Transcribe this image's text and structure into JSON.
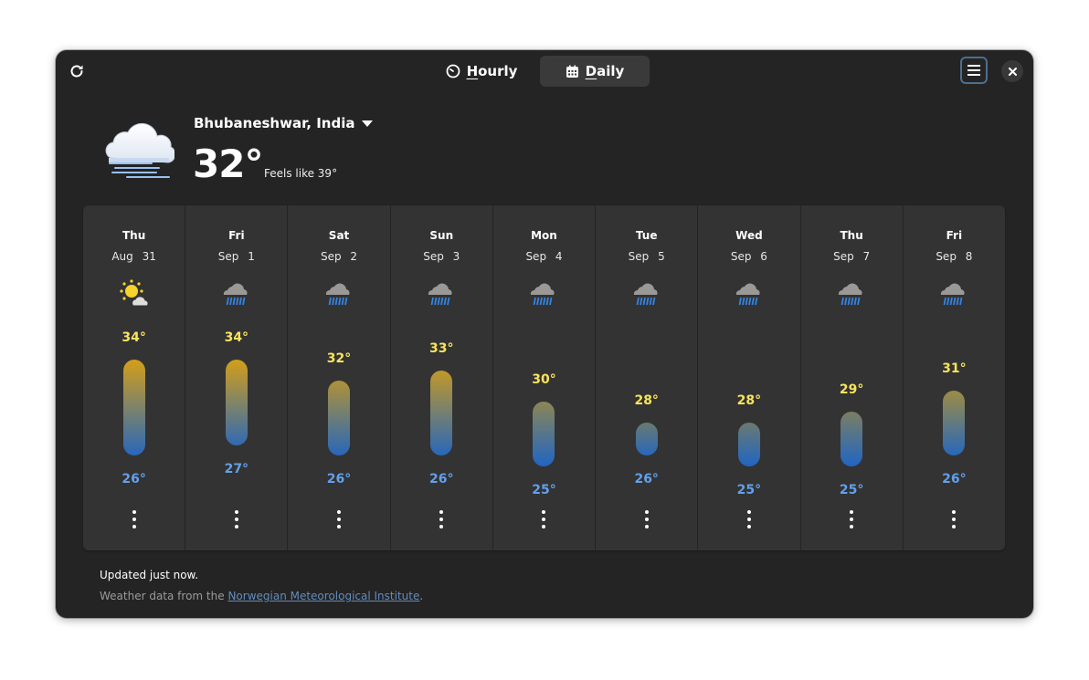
{
  "header": {
    "refresh_icon": "view-refresh-icon",
    "tabs": [
      {
        "label_first": "H",
        "label_rest": "ourly",
        "icon": "clock-icon",
        "active": false
      },
      {
        "label_first": "D",
        "label_rest": "aily",
        "icon": "calendar-icon",
        "active": true
      }
    ],
    "menu_icon": "hamburger-menu-icon",
    "close_icon": "close-icon"
  },
  "current": {
    "icon": "fog-cloud-icon",
    "location": "Bhubaneshwar, India",
    "temperature": "32°",
    "feels_like": "Feels like 39°"
  },
  "forecast": {
    "days": [
      {
        "name": "Thu",
        "date": "Aug 31",
        "icon": "few-clouds-sun-icon",
        "high": "34°",
        "low": "26°",
        "high_value": 34,
        "low_value": 26
      },
      {
        "name": "Fri",
        "date": "Sep 1",
        "icon": "rain-icon",
        "high": "34°",
        "low": "27°",
        "high_value": 34,
        "low_value": 27
      },
      {
        "name": "Sat",
        "date": "Sep 2",
        "icon": "rain-icon",
        "high": "32°",
        "low": "26°",
        "high_value": 32,
        "low_value": 26
      },
      {
        "name": "Sun",
        "date": "Sep 3",
        "icon": "rain-icon",
        "high": "33°",
        "low": "26°",
        "high_value": 33,
        "low_value": 26
      },
      {
        "name": "Mon",
        "date": "Sep 4",
        "icon": "rain-icon",
        "high": "30°",
        "low": "25°",
        "high_value": 30,
        "low_value": 25
      },
      {
        "name": "Tue",
        "date": "Sep 5",
        "icon": "rain-icon",
        "high": "28°",
        "low": "26°",
        "high_value": 28,
        "low_value": 26
      },
      {
        "name": "Wed",
        "date": "Sep 6",
        "icon": "rain-icon",
        "high": "28°",
        "low": "25°",
        "high_value": 28,
        "low_value": 25
      },
      {
        "name": "Thu",
        "date": "Sep 7",
        "icon": "rain-icon",
        "high": "29°",
        "low": "25°",
        "high_value": 29,
        "low_value": 25
      },
      {
        "name": "Fri",
        "date": "Sep 8",
        "icon": "rain-icon",
        "high": "31°",
        "low": "26°",
        "high_value": 31,
        "low_value": 26
      }
    ],
    "colors": {
      "hot": "#e5a50a",
      "cool": "#1c64c8",
      "high_text": "#f8e45c",
      "low_text": "#62a0ea"
    }
  },
  "footer": {
    "updated": "Updated just now.",
    "attribution_prefix": "Weather data from the ",
    "attribution_link": "Norwegian Meteorological Institute",
    "attribution_suffix": "."
  }
}
